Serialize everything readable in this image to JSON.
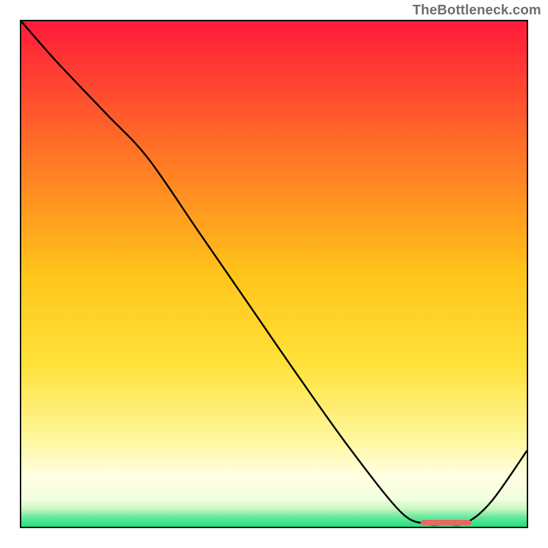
{
  "watermark": "TheBottleneck.com",
  "colors": {
    "top": "#ff1a3a",
    "mid_upper": "#ff8a1f",
    "mid": "#ffd21a",
    "mid_lower": "#ffef5a",
    "pale": "#ffffcf",
    "green": "#1fe07a",
    "curve": "#000000",
    "highlight": "#e46a61",
    "border": "#000000",
    "watermark": "#6d6d6d"
  },
  "chart_data": {
    "type": "line",
    "title": "",
    "xlabel": "",
    "ylabel": "",
    "xlim": [
      0,
      100
    ],
    "ylim": [
      0,
      100
    ],
    "grid": false,
    "legend": false,
    "annotations": [],
    "x": [
      0,
      7,
      17,
      25,
      35,
      45,
      55,
      65,
      75,
      80,
      84,
      88,
      93,
      100
    ],
    "y": [
      100,
      92,
      81.5,
      73,
      58.5,
      44,
      29.5,
      15.5,
      3,
      0.6,
      0.5,
      0.8,
      5,
      15
    ],
    "highlight_range_x": [
      79,
      89
    ],
    "gradient_stops": [
      {
        "pct": 0,
        "color": "#ff1a3a"
      },
      {
        "pct": 28,
        "color": "#ff7a24"
      },
      {
        "pct": 50,
        "color": "#ffc41a"
      },
      {
        "pct": 68,
        "color": "#ffe23a"
      },
      {
        "pct": 83,
        "color": "#fff7a0"
      },
      {
        "pct": 90,
        "color": "#ffffe2"
      },
      {
        "pct": 94.5,
        "color": "#f3ffe0"
      },
      {
        "pct": 96.5,
        "color": "#c8f7c0"
      },
      {
        "pct": 98,
        "color": "#6be9a0"
      },
      {
        "pct": 100,
        "color": "#1fe07a"
      }
    ]
  }
}
